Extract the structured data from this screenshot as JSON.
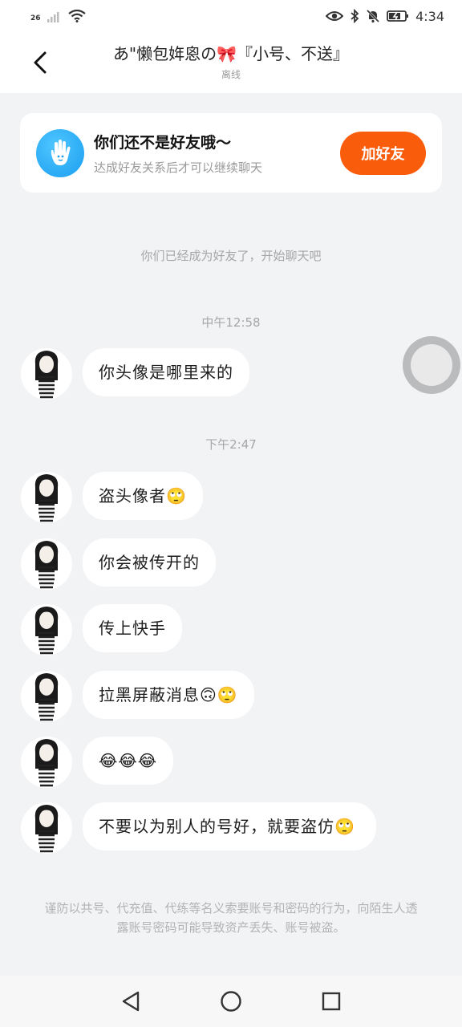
{
  "status_bar": {
    "network": "26",
    "time": "4:34"
  },
  "header": {
    "title": "あ\"懒包姩恖の🎀『小号、不送』",
    "subtitle": "离线"
  },
  "friend_card": {
    "title": "你们还不是好友哦～",
    "subtitle": "达成好友关系后才可以继续聊天",
    "button_label": "加好友"
  },
  "chat": {
    "system_note": "你们已经成为好友了，开始聊天吧",
    "time_1": "中午12:58",
    "time_2": "下午2:47",
    "messages": [
      "你头像是哪里来的",
      "盗头像者🙄",
      "你会被传开的",
      "传上快手",
      "拉黑屏蔽消息🙃🙄",
      "😂😂😂",
      "不要以为别人的号好，就要盗仿🙄"
    ],
    "warning": "谨防以共号、代充值、代练等名义索要账号和密码的行为，向陌生人透露账号密码可能导致资产丢失、账号被盗。"
  }
}
